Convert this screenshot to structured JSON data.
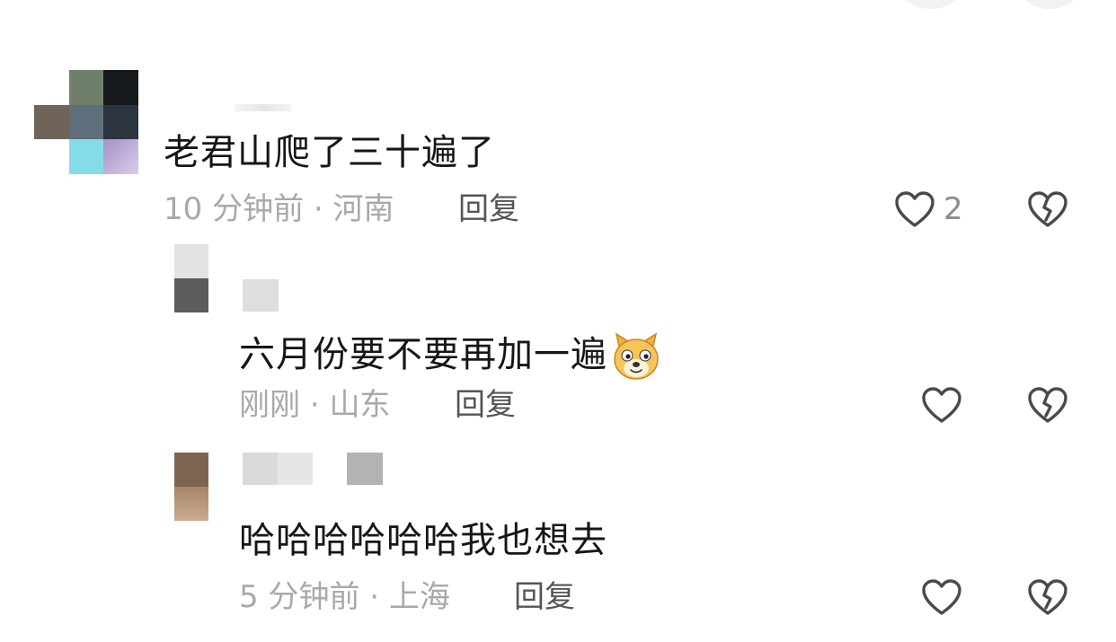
{
  "comments": [
    {
      "text": "老君山爬了三十遍了",
      "time": "10 分钟前",
      "location": "河南",
      "reply_label": "回复",
      "like_count": "2"
    }
  ],
  "replies": [
    {
      "text": "六月份要不要再加一遍",
      "time": "刚刚",
      "location": "山东",
      "reply_label": "回复",
      "like_count": ""
    },
    {
      "text": "哈哈哈哈哈哈我也想去",
      "time": "5 分钟前",
      "location": "上海",
      "reply_label": "回复",
      "like_count": ""
    }
  ],
  "meta_separator": "·",
  "icons": {
    "like": "heart-outline-icon",
    "dislike": "broken-heart-icon",
    "emoji": "doge-emoji-icon"
  },
  "colors": {
    "text": "#161616",
    "meta": "#a9a9a9",
    "reply": "#555555",
    "icon": "#4a4a4a"
  }
}
